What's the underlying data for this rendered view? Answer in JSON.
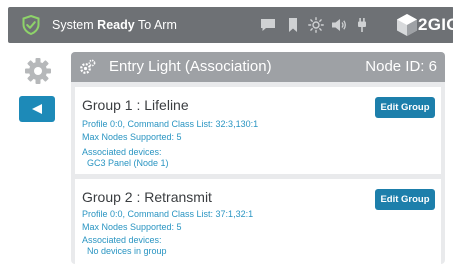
{
  "status": {
    "prefix": "System",
    "bold": "Ready",
    "suffix": "To Arm"
  },
  "brand": {
    "name": "2GIG"
  },
  "top_icons": [
    "message-icon",
    "bookmark-icon",
    "brightness-icon",
    "volume-icon",
    "plug-icon"
  ],
  "panel": {
    "title": "Entry Light (Association)",
    "node_id": "Node ID: 6"
  },
  "groups": [
    {
      "title": "Group 1 : Lifeline",
      "profile": "Profile 0:0, Command Class List: 32:3,130:1",
      "max_nodes": "Max Nodes Supported: 5",
      "assoc_label": "Associated devices:",
      "devices": "GC3 Panel (Node 1)",
      "button": "Edit Group"
    },
    {
      "title": "Group 2 : Retransmit",
      "profile": "Profile 0:0, Command Class List: 37:1,32:1",
      "max_nodes": "Max Nodes Supported: 5",
      "assoc_label": "Associated devices:",
      "devices": "No devices in group",
      "button": "Edit Group"
    }
  ],
  "colors": {
    "topbar": "#6e7175",
    "accent": "#1d8ab8",
    "link_text": "#2a95c2",
    "panel_header": "#9ea1a5",
    "shield": "#8ed36a"
  }
}
